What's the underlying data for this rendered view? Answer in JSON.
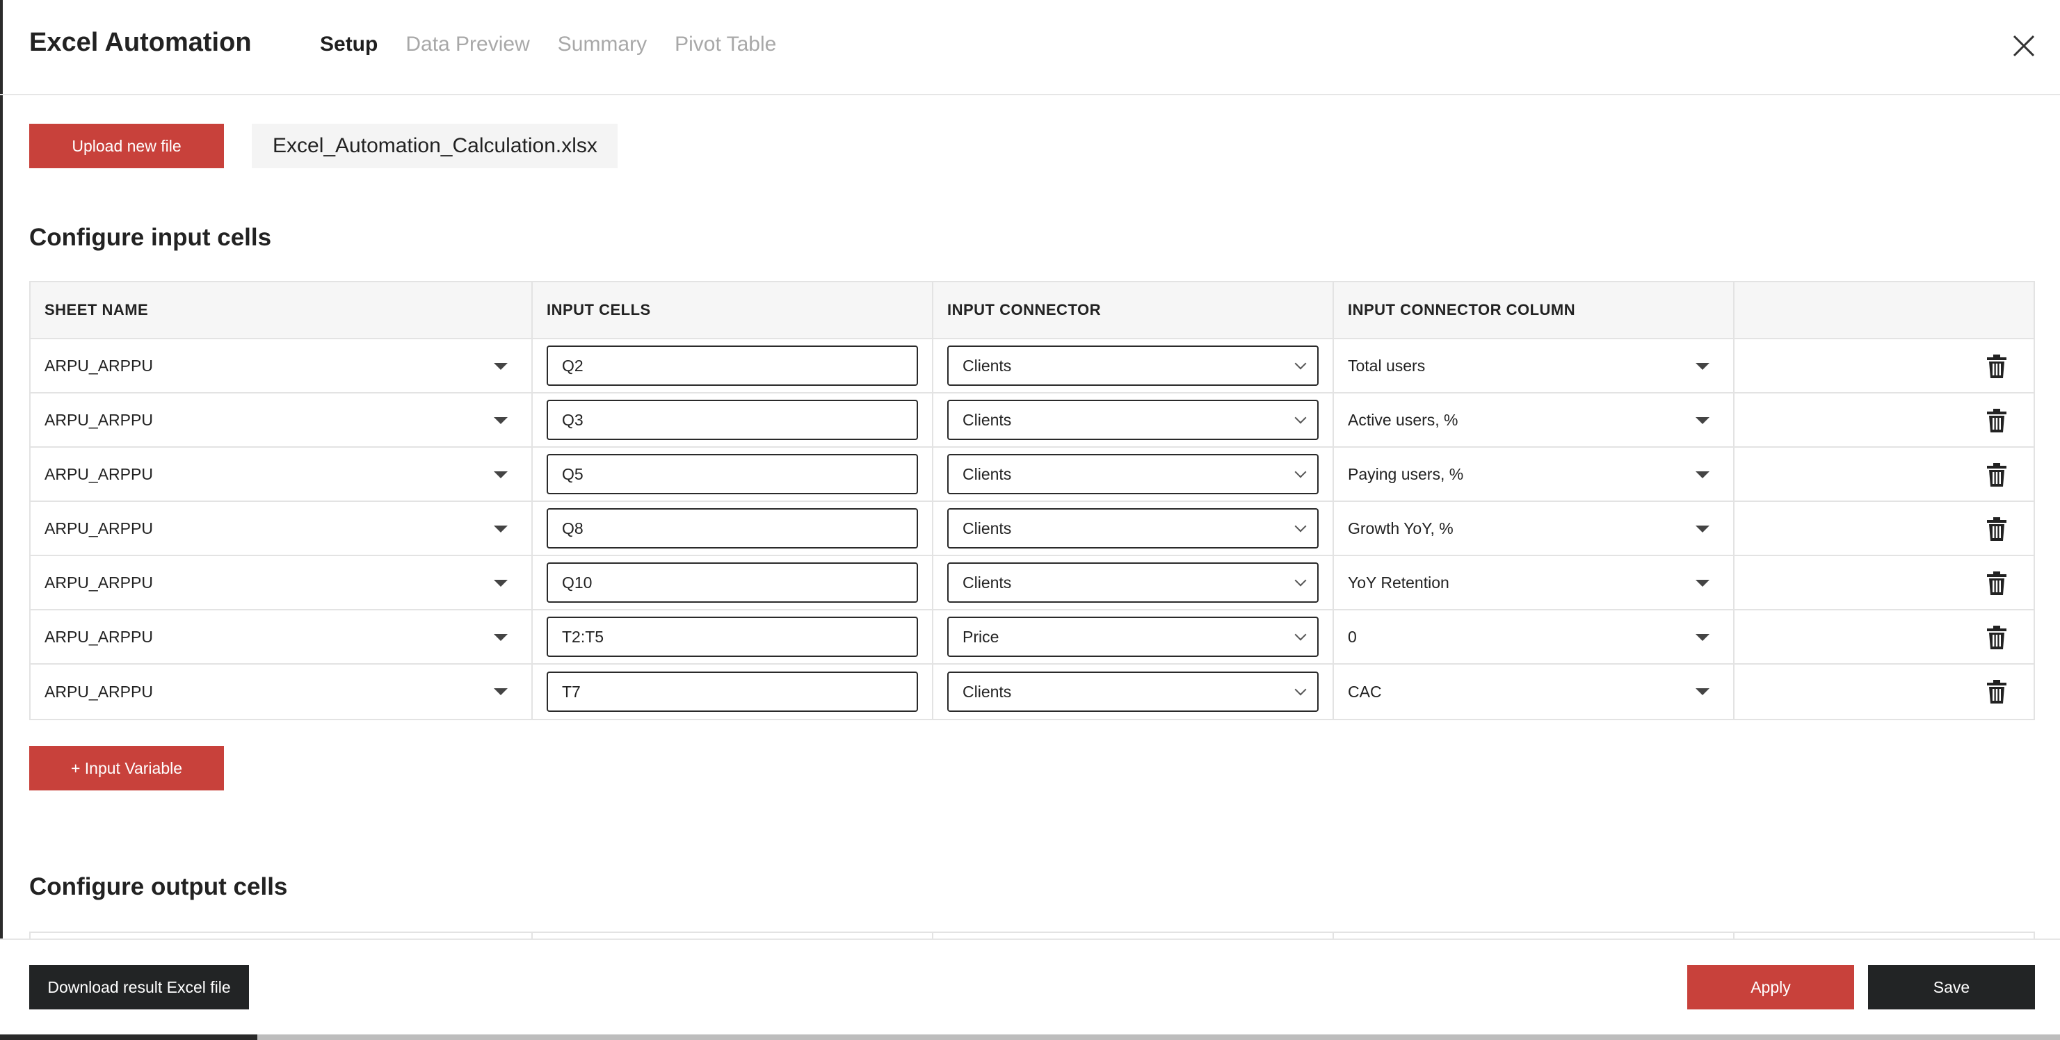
{
  "header": {
    "title": "Excel Automation",
    "tabs": [
      {
        "label": "Setup",
        "active": true
      },
      {
        "label": "Data Preview",
        "active": false
      },
      {
        "label": "Summary",
        "active": false
      },
      {
        "label": "Pivot Table",
        "active": false
      }
    ],
    "close_icon": "close-icon"
  },
  "file": {
    "upload_label": "Upload new file",
    "filename": "Excel_Automation_Calculation.xlsx"
  },
  "input_section": {
    "title": "Configure input cells",
    "columns": [
      "SHEET NAME",
      "INPUT CELLS",
      "INPUT CONNECTOR",
      "INPUT CONNECTOR COLUMN",
      ""
    ],
    "rows": [
      {
        "sheet": "ARPU_ARPPU",
        "cells": "Q2",
        "connector": "Clients",
        "column": "Total users"
      },
      {
        "sheet": "ARPU_ARPPU",
        "cells": "Q3",
        "connector": "Clients",
        "column": "Active users, %"
      },
      {
        "sheet": "ARPU_ARPPU",
        "cells": "Q5",
        "connector": "Clients",
        "column": "Paying users, %"
      },
      {
        "sheet": "ARPU_ARPPU",
        "cells": "Q8",
        "connector": "Clients",
        "column": "Growth YoY, %"
      },
      {
        "sheet": "ARPU_ARPPU",
        "cells": "Q10",
        "connector": "Clients",
        "column": "YoY Retention"
      },
      {
        "sheet": "ARPU_ARPPU",
        "cells": "T2:T5",
        "connector": "Price",
        "column": "0"
      },
      {
        "sheet": "ARPU_ARPPU",
        "cells": "T7",
        "connector": "Clients",
        "column": "CAC"
      }
    ],
    "add_label": "+ Input Variable"
  },
  "output_section": {
    "title": "Configure output cells"
  },
  "footer": {
    "download_label": "Download result Excel file",
    "apply_label": "Apply",
    "save_label": "Save"
  },
  "colors": {
    "accent": "#c8413b",
    "dark": "#222425"
  }
}
